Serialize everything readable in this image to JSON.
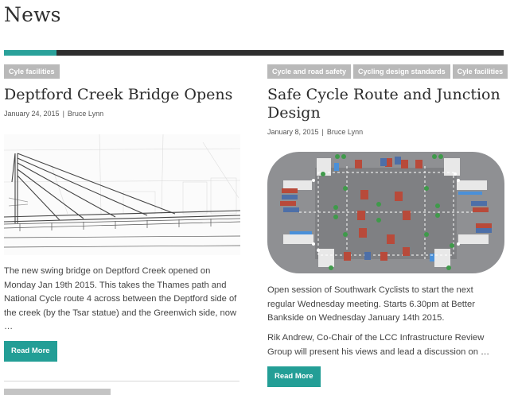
{
  "page": {
    "title": "News"
  },
  "colors": {
    "accent": "#2aa19a",
    "tag_bg": "#b9b9b9",
    "button_bg": "#239e96"
  },
  "posts": [
    {
      "tags": [
        "Cyle facilities"
      ],
      "title": "Deptford Creek Bridge Opens",
      "date": "January 24, 2015",
      "author": "Bruce Lynn",
      "image": "bridge-sketch-image",
      "excerpts": [
        "The new swing bridge on Deptford Creek opened on Monday Jan 19th 2015.  This takes the Thames path and National Cycle route 4 across between the Deptford side of the creek (by the Tsar statue) and the Greenwich side, now …"
      ],
      "read_more": "Read More"
    },
    {
      "tags": [
        "Cycle and road safety",
        "Cycling design standards",
        "Cyle facilities"
      ],
      "title": "Safe Cycle Route and Junction Design",
      "date": "January 8, 2015",
      "author": "Bruce Lynn",
      "image": "junction-diagram-image",
      "excerpts": [
        "Open session of Southwark Cyclists to start the next regular Wednesday meeting.  Starts 6.30pm at Better Bankside on Wednesday January 14th 2015.",
        "Rik Andrew, Co-Chair of the LCC Infrastructure Review Group will present his views and lead a discussion on …"
      ],
      "read_more": "Read More"
    }
  ]
}
